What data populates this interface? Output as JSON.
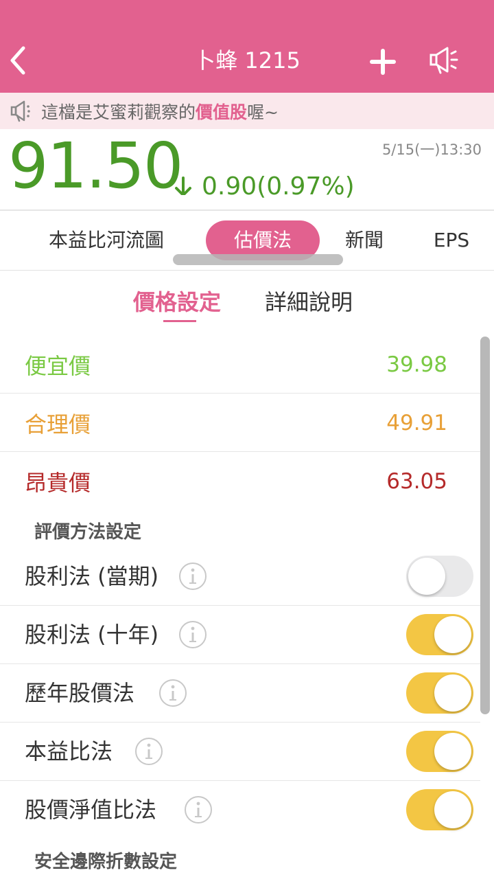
{
  "header": {
    "title": "卜蜂 1215",
    "back_icon": "chevron-left-icon",
    "add_icon": "plus-icon",
    "speaker_icon": "megaphone-icon",
    "color": "#e2618f"
  },
  "notice": {
    "icon": "megaphone-icon",
    "prefix": "這檔是艾蜜莉觀察的",
    "highlight": "價值股",
    "suffix": "喔~"
  },
  "quote": {
    "price": "91.50",
    "direction_icon": "arrow-down-icon",
    "change": "0.90",
    "change_pct": "(0.97%)",
    "time": "5/15(一)13:30",
    "color": "#4a9a28"
  },
  "tabs": [
    {
      "label": "本益比河流圖"
    },
    {
      "label": "估價法",
      "active": true
    },
    {
      "label": "新聞"
    },
    {
      "label": "EPS"
    }
  ],
  "subtabs": [
    {
      "label": "價格設定",
      "active": true
    },
    {
      "label": "詳細說明"
    }
  ],
  "prices": [
    {
      "label": "便宜價",
      "value": "39.98",
      "color": "#7ac943"
    },
    {
      "label": "合理價",
      "value": "49.91",
      "color": "#e8a037"
    },
    {
      "label": "昂貴價",
      "value": "63.05",
      "color": "#b52a2a"
    }
  ],
  "valuation_methods_title": "評價方法設定",
  "methods": [
    {
      "label": "股利法 (當期)",
      "enabled": false
    },
    {
      "label": "股利法 (十年)",
      "enabled": true
    },
    {
      "label": "歷年股價法",
      "enabled": true
    },
    {
      "label": "本益比法",
      "enabled": true
    },
    {
      "label": "股價淨值比法",
      "enabled": true
    }
  ],
  "safety_margin_title": "安全邊際折數設定",
  "toggle_on_color": "#f3c644"
}
